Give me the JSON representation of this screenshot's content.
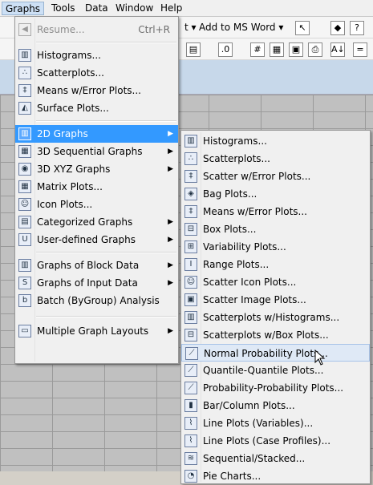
{
  "menubar": [
    {
      "label": "Graphs",
      "accel": "G"
    },
    {
      "label": "Tools",
      "accel": "T"
    },
    {
      "label": "Data",
      "accel": "D"
    },
    {
      "label": "Window",
      "accel": "W"
    },
    {
      "label": "Help",
      "accel": "H"
    }
  ],
  "toolbar": {
    "fragment": "t ▾",
    "add_to_word": "Add to MS Word ▾"
  },
  "graphs_menu": {
    "resume": {
      "label": "Resume...",
      "shortcut": "Ctrl+R"
    },
    "items": [
      {
        "label": "Histograms..."
      },
      {
        "label": "Scatterplots..."
      },
      {
        "label": "Means w/Error Plots..."
      },
      {
        "label": "Surface Plots..."
      },
      {
        "label": "2D Graphs"
      },
      {
        "label": "3D Sequential Graphs"
      },
      {
        "label": "3D XYZ Graphs"
      },
      {
        "label": "Matrix Plots..."
      },
      {
        "label": "Icon Plots..."
      },
      {
        "label": "Categorized Graphs"
      },
      {
        "label": "User-defined Graphs"
      },
      {
        "label": "Graphs of Block Data"
      },
      {
        "label": "Graphs of Input Data"
      },
      {
        "label": "Batch (ByGroup) Analysis"
      },
      {
        "label": "Multiple Graph Layouts"
      }
    ]
  },
  "submenu_2d": {
    "items": [
      {
        "label": "Histograms..."
      },
      {
        "label": "Scatterplots..."
      },
      {
        "label": "Scatter w/Error Plots..."
      },
      {
        "label": "Bag Plots..."
      },
      {
        "label": "Means w/Error Plots..."
      },
      {
        "label": "Box Plots..."
      },
      {
        "label": "Variability Plots..."
      },
      {
        "label": "Range Plots..."
      },
      {
        "label": "Scatter Icon Plots..."
      },
      {
        "label": "Scatter Image Plots..."
      },
      {
        "label": "Scatterplots w/Histograms..."
      },
      {
        "label": "Scatterplots w/Box Plots..."
      },
      {
        "label": "Normal Probability Plots..."
      },
      {
        "label": "Quantile-Quantile Plots..."
      },
      {
        "label": "Probability-Probability Plots..."
      },
      {
        "label": "Bar/Column Plots..."
      },
      {
        "label": "Line Plots (Variables)..."
      },
      {
        "label": "Line Plots (Case Profiles)..."
      },
      {
        "label": "Sequential/Stacked..."
      },
      {
        "label": "Pie Charts..."
      }
    ]
  }
}
